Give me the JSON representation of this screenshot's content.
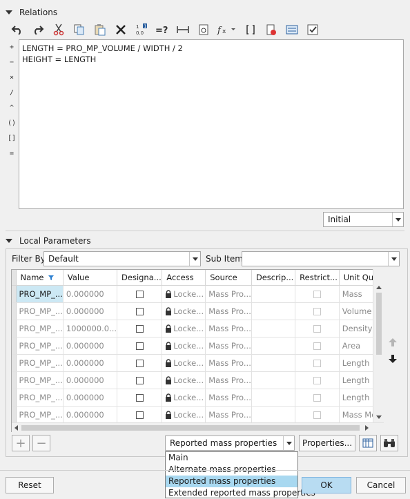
{
  "relations": {
    "header": "Relations",
    "operators": [
      "+",
      "−",
      "×",
      "/",
      "^",
      "()",
      "[]",
      "="
    ],
    "editor_text": "LENGTH = PRO_MP_VOLUME / WIDTH / 2\nHEIGHT = LENGTH",
    "initial_combo": "Initial"
  },
  "local_parameters": {
    "header": "Local Parameters",
    "filter_by_label": "Filter By",
    "filter_by_value": "Default",
    "sub_items_label": "Sub Items",
    "sub_items_value": "",
    "columns": [
      "Name",
      "Value",
      "Designa...",
      "Access",
      "Source",
      "Descrip...",
      "Restrict...",
      "Unit Qu..."
    ],
    "rows": [
      {
        "name": "PRO_MP_...",
        "value": "0.000000",
        "access": "Locke...",
        "source": "Mass Pro...",
        "unit": "Mass"
      },
      {
        "name": "PRO_MP_...",
        "value": "0.000000",
        "access": "Locke...",
        "source": "Mass Pro...",
        "unit": "Volume"
      },
      {
        "name": "PRO_MP_...",
        "value": "1000000.0...",
        "access": "Locke...",
        "source": "Mass Pro...",
        "unit": "Density"
      },
      {
        "name": "PRO_MP_...",
        "value": "0.000000",
        "access": "Locke...",
        "source": "Mass Pro...",
        "unit": "Area"
      },
      {
        "name": "PRO_MP_...",
        "value": "0.000000",
        "access": "Locke...",
        "source": "Mass Pro...",
        "unit": "Length"
      },
      {
        "name": "PRO_MP_...",
        "value": "0.000000",
        "access": "Locke...",
        "source": "Mass Pro...",
        "unit": "Length"
      },
      {
        "name": "PRO_MP_...",
        "value": "0.000000",
        "access": "Locke...",
        "source": "Mass Pro...",
        "unit": "Length"
      },
      {
        "name": "PRO_MP_...",
        "value": "0.000000",
        "access": "Locke...",
        "source": "Mass Pro...",
        "unit": "Mass Mo"
      }
    ],
    "add_label": "+",
    "remove_label": "−",
    "view_combo": "Reported mass properties",
    "properties_button": "Properties...",
    "view_options": [
      "Main",
      "Alternate mass properties",
      "Reported mass properties",
      "Extended reported mass properties"
    ]
  },
  "footer": {
    "reset": "Reset",
    "ok": "OK",
    "cancel": "Cancel"
  },
  "colors": {
    "selected_cell": "#cce8f4",
    "primary_button": "#b8dcf2",
    "highlight_item": "#a8d8f0"
  }
}
